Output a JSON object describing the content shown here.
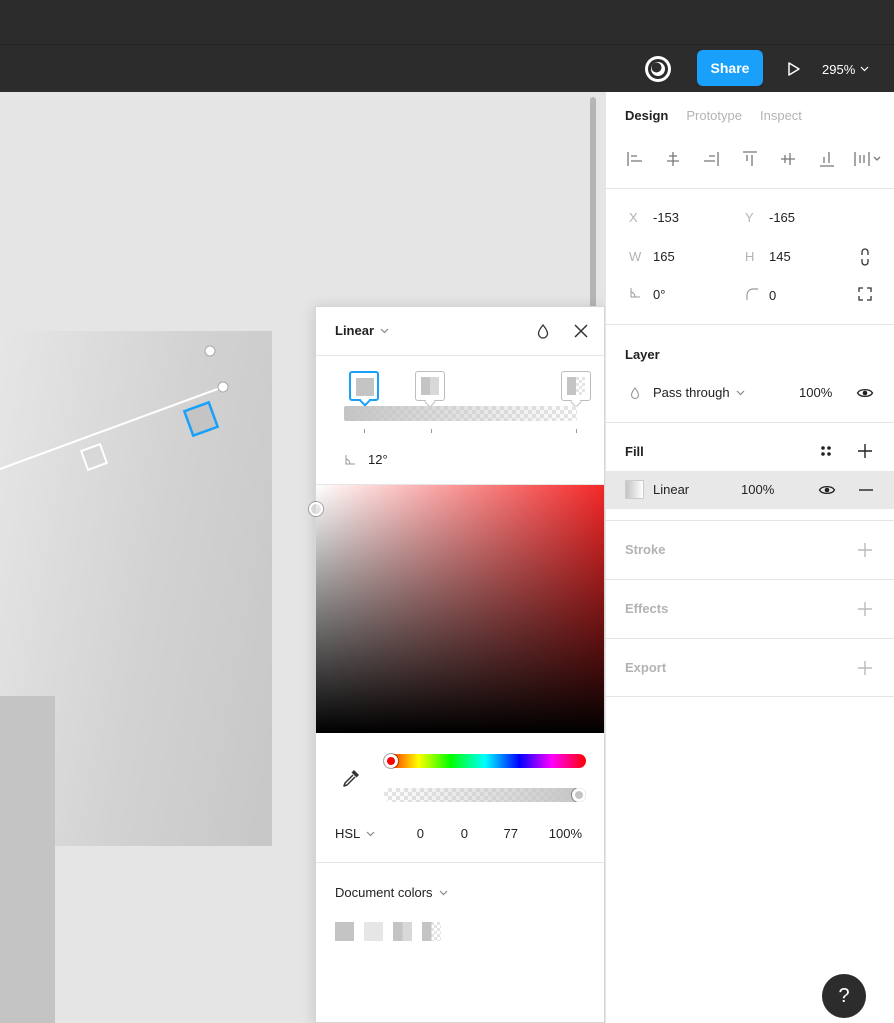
{
  "toolbar": {
    "share_label": "Share",
    "zoom_label": "295%",
    "multiplayer_icon": "multiplayer-icon",
    "play_icon": "play-icon"
  },
  "picker": {
    "type_label": "Linear",
    "angle_value": "12°",
    "color_mode": "HSL",
    "h": "0",
    "s": "0",
    "l": "77",
    "alpha": "100%",
    "doc_colors_label": "Document colors",
    "hue_fraction": 0,
    "alpha_fraction": 1,
    "doc_swatches": [
      "#c4c4c4",
      "#e6e6e6",
      "gradient-a",
      "gradient-b"
    ]
  },
  "panel": {
    "tabs": [
      "Design",
      "Prototype",
      "Inspect"
    ],
    "x_label": "X",
    "x_value": "-153",
    "y_label": "Y",
    "y_value": "-165",
    "w_label": "W",
    "w_value": "165",
    "h_label": "H",
    "h_value": "145",
    "rotation_value": "0°",
    "radius_value": "0",
    "layer_title": "Layer",
    "blend_mode": "Pass through",
    "layer_opacity": "100%",
    "fill_title": "Fill",
    "fill_type": "Linear",
    "fill_opacity": "100%",
    "stroke_title": "Stroke",
    "effects_title": "Effects",
    "export_title": "Export"
  },
  "help_label": "?",
  "colors": {
    "accent": "#18a0fb",
    "dark_bar": "#2c2c2c",
    "fill_gray": "#c4c4c4"
  }
}
